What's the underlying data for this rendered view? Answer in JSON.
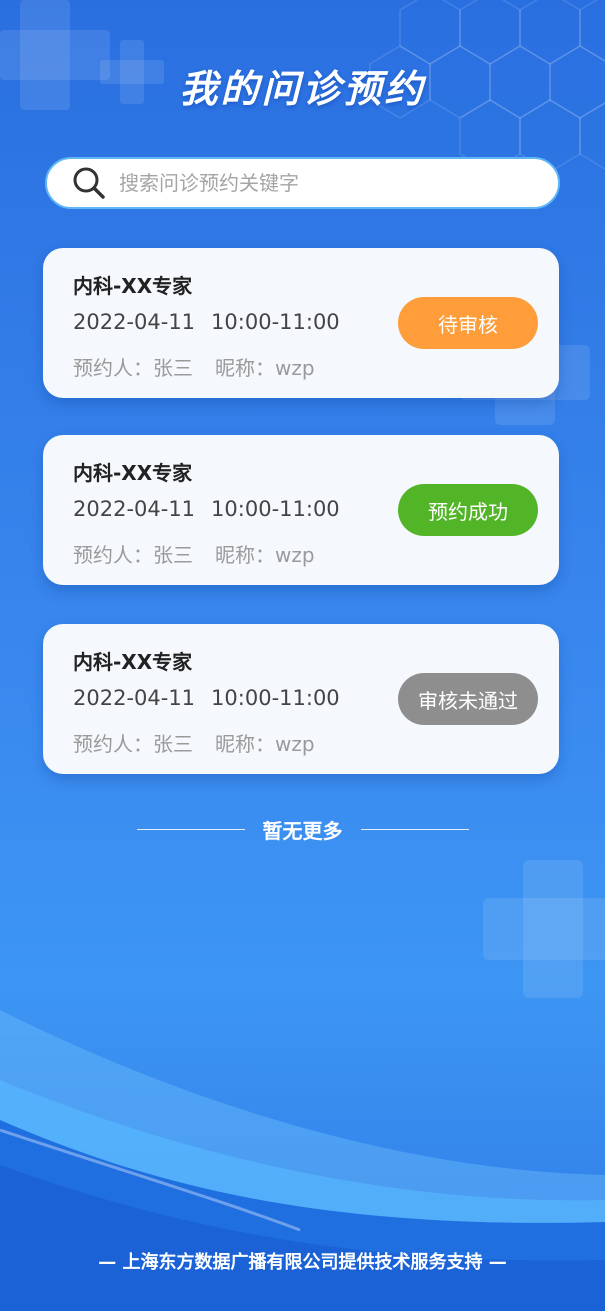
{
  "page": {
    "title": "我的问诊预约"
  },
  "search": {
    "placeholder": "搜索问诊预约关键字",
    "icon": "search-icon"
  },
  "appointments": [
    {
      "name": "内科-XX专家",
      "date": "2022-04-11",
      "time": "10:00-11:00",
      "booker_label": "预约人：",
      "booker": "张三",
      "nickname_label": "昵称：",
      "nickname": "wzp",
      "status": "待审核",
      "status_color": "#ff9d3b"
    },
    {
      "name": "内科-XX专家",
      "date": "2022-04-11",
      "time": "10:00-11:00",
      "booker_label": "预约人：",
      "booker": "张三",
      "nickname_label": "昵称：",
      "nickname": "wzp",
      "status": "预约成功",
      "status_color": "#52b528"
    },
    {
      "name": "内科-XX专家",
      "date": "2022-04-11",
      "time": "10:00-11:00",
      "booker_label": "预约人：",
      "booker": "张三",
      "nickname_label": "昵称：",
      "nickname": "wzp",
      "status": "审核未通过",
      "status_color": "#8e8e8e"
    }
  ],
  "list_end": {
    "text": "暂无更多"
  },
  "footer": {
    "text": "— 上海东方数据广播有限公司提供技术服务支持 —"
  },
  "colors": {
    "background_top": "#2a6fe0",
    "background_bottom": "#3d96f3",
    "search_border": "#5fb7f6"
  }
}
